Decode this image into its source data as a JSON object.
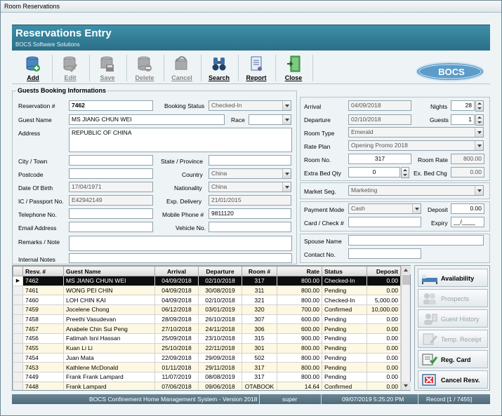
{
  "window": {
    "title": "Room Reservations"
  },
  "header": {
    "title": "Reservations Entry",
    "subtitle": "BOCS Software Solutions"
  },
  "logo": {
    "text": "BOCS"
  },
  "toolbar": [
    {
      "label": "Add",
      "icon": "add-database-icon",
      "disabled": false
    },
    {
      "label": "Edit",
      "icon": "edit-pencil-icon",
      "disabled": true
    },
    {
      "label": "Save",
      "icon": "save-floppy-icon",
      "disabled": true
    },
    {
      "label": "Delete",
      "icon": "delete-database-icon",
      "disabled": true
    },
    {
      "label": "Cancel",
      "icon": "undo-cancel-icon",
      "disabled": true
    },
    {
      "label": "Search",
      "icon": "search-binoculars-icon",
      "disabled": false
    },
    {
      "label": "Report",
      "icon": "report-scroll-icon",
      "disabled": false
    },
    {
      "label": "Close",
      "icon": "exit-door-icon",
      "disabled": false
    }
  ],
  "guest": {
    "legend": "Guests Booking Informations",
    "reservation_label": "Reservation #",
    "reservation": "7462",
    "booking_status_label": "Booking Status",
    "booking_status": "Checked-In",
    "guest_name_label": "Guest Name",
    "guest_name": "MS JIANG CHUN WEI",
    "race_label": "Race",
    "race": "",
    "address_label": "Address",
    "address": "REPUBLIC OF CHINA",
    "city_label": "City / Town",
    "city": "",
    "state_label": "State / Province",
    "state": "",
    "postcode_label": "Postcode",
    "postcode": "",
    "country_label": "Country",
    "country": "China",
    "dob_label": "Date Of Birth",
    "dob": "17/04/1971",
    "nationality_label": "Nationality",
    "nationality": "China",
    "ic_label": "IC / Passport No.",
    "ic": "E42942149",
    "exp_label": "Exp. Delivery",
    "exp": "21/01/2015",
    "tel_label": "Telephone No.",
    "tel": "",
    "mobile_label": "Mobile Phone #",
    "mobile": "9811120",
    "email_label": "Email Address",
    "email": "",
    "vehicle_label": "Vehicle No.",
    "vehicle": "",
    "remarks_label": "Remarks / Note",
    "remarks": "",
    "internal_label": "Internal Notes",
    "internal": ""
  },
  "stay": {
    "arrival_label": "Arrival",
    "arrival": "04/09/2018",
    "nights_label": "Nights",
    "nights": "28",
    "departure_label": "Departure",
    "departure": "02/10/2018",
    "guests_label": "Guests",
    "guests": "1",
    "room_type_label": "Room Type",
    "room_type": "Emerald",
    "rate_plan_label": "Rate Plan",
    "rate_plan": "Opening Promo 2018",
    "room_no_label": "Room No.",
    "room_no": "317",
    "room_rate_label": "Room Rate",
    "room_rate": "800.00",
    "extra_bed_label": "Extra Bed Qty",
    "extra_bed": "0",
    "ex_bed_chg_label": "Ex. Bed Chg",
    "ex_bed_chg": "0.00",
    "market_label": "Market Seg.",
    "market": "Marketing",
    "payment_label": "Payment Mode",
    "payment": "Cash",
    "deposit_label": "Deposit",
    "deposit": "0.00",
    "card_label": "Card / Check #",
    "card": "",
    "expiry_label": "Expiry",
    "expiry": "__/____",
    "spouse_label": "Spouse Name",
    "spouse": "",
    "contact_label": "Contact No.",
    "contact": ""
  },
  "grid": {
    "columns": [
      "Resv. #",
      "Guest Name",
      "Arrival",
      "Departure",
      "Room #",
      "Rate",
      "Status",
      "Deposit"
    ],
    "rows": [
      [
        "7462",
        "MS JIANG CHUN WEI",
        "04/09/2018",
        "02/10/2018",
        "317",
        "800.00",
        "Checked-In",
        "0.00"
      ],
      [
        "7461",
        "WONG PEI CHIN",
        "04/09/2018",
        "30/08/2019",
        "311",
        "800.00",
        "Pending",
        "0.00"
      ],
      [
        "7460",
        "LOH CHIN KAI",
        "04/09/2018",
        "02/10/2018",
        "321",
        "800.00",
        "Checked-In",
        "5,000.00"
      ],
      [
        "7459",
        "Jocelene Chong",
        "06/12/2018",
        "03/01/2019",
        "320",
        "700.00",
        "Confirmed",
        "10,000.00"
      ],
      [
        "7458",
        "Preethi Vasudevan",
        "28/09/2018",
        "26/10/2018",
        "307",
        "600.00",
        "Pending",
        "0.00"
      ],
      [
        "7457",
        "Anabele Chin Sui Peng",
        "27/10/2018",
        "24/11/2018",
        "306",
        "600.00",
        "Pending",
        "0.00"
      ],
      [
        "7456",
        "Fatimah Isni Hassan",
        "25/09/2018",
        "23/10/2018",
        "315",
        "900.00",
        "Pending",
        "0.00"
      ],
      [
        "7455",
        "Kuan Li Li",
        "25/10/2018",
        "22/11/2018",
        "301",
        "800.00",
        "Pending",
        "0.00"
      ],
      [
        "7454",
        "Juan  Mata",
        "22/09/2018",
        "29/09/2018",
        "502",
        "800.00",
        "Pending",
        "0.00"
      ],
      [
        "7453",
        "Kathlene  McDonald",
        "01/11/2018",
        "29/11/2018",
        "317",
        "800.00",
        "Pending",
        "0.00"
      ],
      [
        "7449",
        "Frank Frank Lampard",
        "11/07/2019",
        "08/08/2019",
        "317",
        "800.00",
        "Pending",
        "0.00"
      ],
      [
        "7448",
        "Frank  Lampard",
        "07/06/2018",
        "09/06/2018",
        "OTABOOK",
        "14.64",
        "Confirmed",
        "0.00"
      ]
    ]
  },
  "side_buttons": [
    {
      "label": "Availability",
      "icon": "availability-bed-icon",
      "disabled": false
    },
    {
      "label": "Prospects",
      "icon": "prospects-people-icon",
      "disabled": true
    },
    {
      "label": "Guest History",
      "icon": "guest-history-icon",
      "disabled": true
    },
    {
      "label": "Temp. Receipt",
      "icon": "temp-receipt-icon",
      "disabled": true
    },
    {
      "label": "Reg. Card",
      "icon": "reg-card-icon",
      "disabled": false
    },
    {
      "label": "Cancel Resv.",
      "icon": "cancel-resv-icon",
      "disabled": false
    }
  ],
  "status": {
    "system": "BOCS Confinement Home Management System - Version 2018",
    "user": "super",
    "datetime": "09/07/2019 5:25:20 PM",
    "record": "Record  [1 / 7455]"
  }
}
